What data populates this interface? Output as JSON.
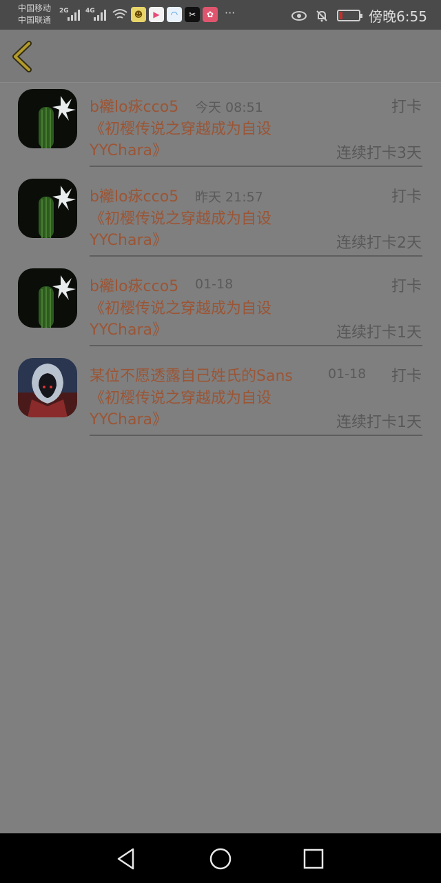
{
  "status_bar": {
    "carrier1": "中国移动",
    "carrier2": "中国联通",
    "net1": "2G",
    "net2": "4G",
    "more": "···",
    "time": "傍晚6:55",
    "icons": [
      "eye-icon",
      "bell-off-icon",
      "battery-icon"
    ]
  },
  "header": {
    "back_icon": "chevron-left-icon"
  },
  "checkins": [
    {
      "name": "b䙰lo㽷cco5",
      "time": "今天 08:51",
      "action": "打卡",
      "book": "《初樱传说之穿越成为自设YYChara》",
      "streak": "连续打卡3天",
      "avatar": "cactus"
    },
    {
      "name": "b䙰lo㽷cco5",
      "time": "昨天 21:57",
      "action": "打卡",
      "book": "《初樱传说之穿越成为自设YYChara》",
      "streak": "连续打卡2天",
      "avatar": "cactus"
    },
    {
      "name": "b䙰lo㽷cco5",
      "time": "01-18",
      "action": "打卡",
      "book": "《初樱传说之穿越成为自设YYChara》",
      "streak": "连续打卡1天",
      "avatar": "cactus"
    },
    {
      "name": "某位不愿透露自己姓氏的Sans",
      "time": "01-18",
      "action": "打卡",
      "book": "《初樱传说之穿越成为自设YYChara》",
      "streak": "连续打卡1天",
      "avatar": "hooded"
    }
  ],
  "nav": {
    "back": "triangle-back-icon",
    "home": "circle-home-icon",
    "recents": "square-recents-icon"
  },
  "colors": {
    "name": "#9b5535",
    "secondary": "#585858",
    "background": "#7f7f7f"
  }
}
